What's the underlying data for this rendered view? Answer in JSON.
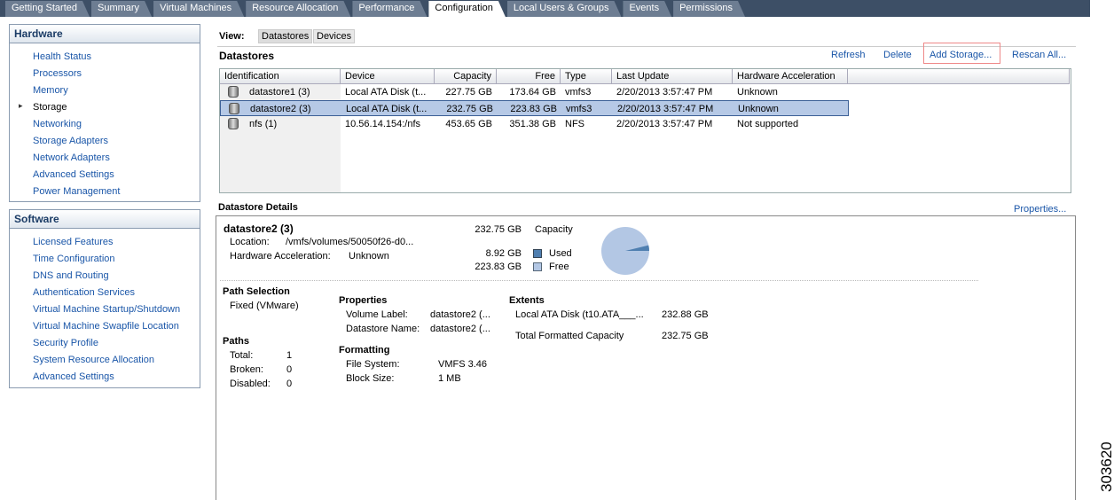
{
  "tabs": [
    "Getting Started",
    "Summary",
    "Virtual Machines",
    "Resource Allocation",
    "Performance",
    "Configuration",
    "Local Users & Groups",
    "Events",
    "Permissions"
  ],
  "hardware": {
    "title": "Hardware",
    "items": [
      "Health Status",
      "Processors",
      "Memory",
      "Storage",
      "Networking",
      "Storage Adapters",
      "Network Adapters",
      "Advanced Settings",
      "Power Management"
    ]
  },
  "software": {
    "title": "Software",
    "items": [
      "Licensed Features",
      "Time Configuration",
      "DNS and Routing",
      "Authentication Services",
      "Virtual Machine Startup/Shutdown",
      "Virtual Machine Swapfile Location",
      "Security Profile",
      "System Resource Allocation",
      "Advanced Settings"
    ]
  },
  "view": {
    "label": "View:",
    "datastores": "Datastores",
    "devices": "Devices"
  },
  "datastores": {
    "title": "Datastores",
    "actions": {
      "refresh": "Refresh",
      "delete": "Delete",
      "add": "Add Storage...",
      "rescan": "Rescan All..."
    },
    "columns": [
      "Identification",
      "Device",
      "Capacity",
      "Free",
      "Type",
      "Last Update",
      "Hardware Acceleration"
    ],
    "rows": [
      [
        "datastore1 (3)",
        "Local ATA Disk (t...",
        "227.75 GB",
        "173.64 GB",
        "vmfs3",
        "2/20/2013 3:57:47 PM",
        "Unknown"
      ],
      [
        "datastore2 (3)",
        "Local ATA Disk (t...",
        "232.75 GB",
        "223.83 GB",
        "vmfs3",
        "2/20/2013 3:57:47 PM",
        "Unknown"
      ],
      [
        "nfs (1)",
        "10.56.14.154:/nfs",
        "453.65 GB",
        "351.38 GB",
        "NFS",
        "2/20/2013 3:57:47 PM",
        "Not supported"
      ]
    ]
  },
  "details": {
    "title": "Datastore Details",
    "properties_link": "Properties...",
    "name": "datastore2 (3)",
    "location_label": "Location:",
    "location": "/vmfs/volumes/50050f26-d0...",
    "hwaccel_label": "Hardware Acceleration:",
    "hwaccel": "Unknown",
    "capacity": "232.75 GB",
    "capacity_label": "Capacity",
    "used": "8.92 GB",
    "used_label": "Used",
    "free": "223.83 GB",
    "free_label": "Free",
    "used_color": "#4f7fb0",
    "free_color": "#b3c7e4",
    "used_fraction": 0.0383,
    "path_selection_title": "Path Selection",
    "path_selection": "Fixed (VMware)",
    "paths_title": "Paths",
    "total_label": "Total:",
    "total": "1",
    "broken_label": "Broken:",
    "broken": "0",
    "disabled_label": "Disabled:",
    "disabled": "0",
    "properties_title": "Properties",
    "volume_label_label": "Volume Label:",
    "volume_label": "datastore2 (...",
    "ds_name_label": "Datastore Name:",
    "ds_name": "datastore2 (...",
    "formatting_title": "Formatting",
    "fs_label": "File System:",
    "fs": "VMFS 3.46",
    "bs_label": "Block Size:",
    "bs": "1 MB",
    "extents_title": "Extents",
    "extent_name": "Local ATA Disk (t10.ATA___...",
    "extent_size": "232.88 GB",
    "total_fmt_label": "Total Formatted Capacity",
    "total_fmt": "232.75 GB"
  },
  "figure_id": "303620"
}
